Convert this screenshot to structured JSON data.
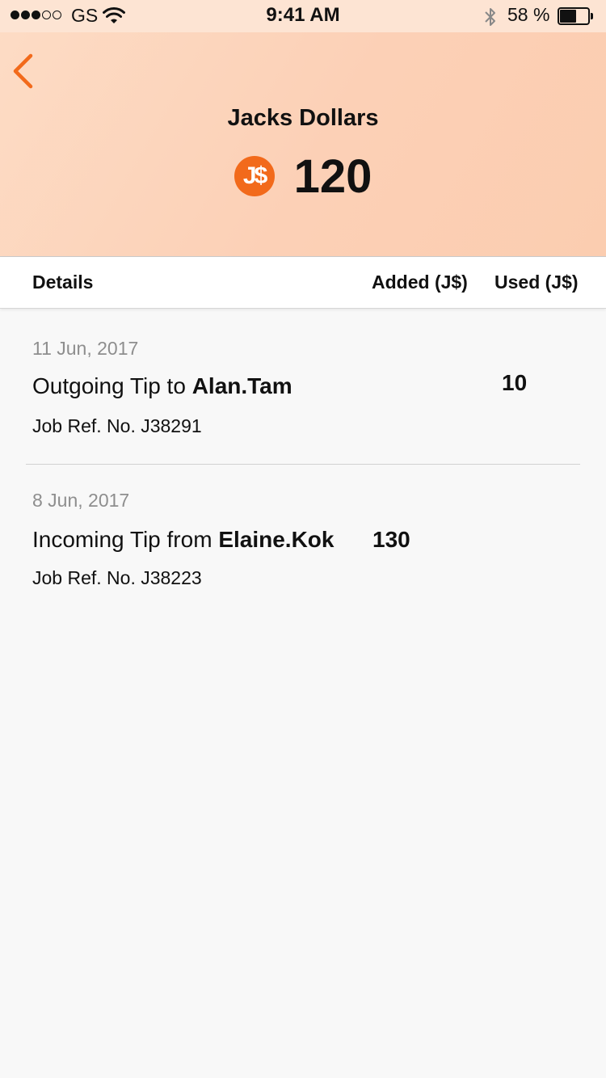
{
  "status_bar": {
    "carrier": "GS",
    "time": "9:41 AM",
    "battery_percent": "58 %",
    "battery_level": 0.58,
    "signal_bars_filled": 3,
    "signal_bars_total": 5
  },
  "header": {
    "title": "Jacks Dollars",
    "currency_symbol": "J$",
    "balance": "120"
  },
  "columns": {
    "details": "Details",
    "added": "Added (J$)",
    "used": "Used (J$)"
  },
  "transactions": [
    {
      "date": "11 Jun, 2017",
      "prefix": "Outgoing Tip to ",
      "counterparty": "Alan.Tam",
      "ref": "Job Ref. No. J38291",
      "added": "",
      "used": "10"
    },
    {
      "date": "8 Jun, 2017",
      "prefix": "Incoming Tip from ",
      "counterparty": "Elaine.Kok",
      "ref": "Job Ref. No. J38223",
      "added": "130",
      "used": ""
    }
  ],
  "colors": {
    "accent": "#f26a1b",
    "header_gradient_start": "#fddcc5",
    "header_gradient_end": "#fbcdb0",
    "background": "#f8f8f8"
  },
  "icons": {
    "back": "chevron-left-icon",
    "currency": "jacks-dollar-coin-icon",
    "wifi": "wifi-icon",
    "bluetooth": "bluetooth-icon",
    "battery": "battery-icon"
  }
}
